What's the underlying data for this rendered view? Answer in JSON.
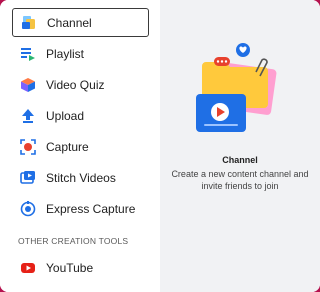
{
  "menu": {
    "items": [
      {
        "label": "Channel",
        "icon": "channel-icon"
      },
      {
        "label": "Playlist",
        "icon": "playlist-icon"
      },
      {
        "label": "Video Quiz",
        "icon": "video-quiz-icon"
      },
      {
        "label": "Upload",
        "icon": "upload-icon"
      },
      {
        "label": "Capture",
        "icon": "capture-icon"
      },
      {
        "label": "Stitch Videos",
        "icon": "stitch-videos-icon"
      },
      {
        "label": "Express Capture",
        "icon": "express-capture-icon"
      }
    ],
    "selected": "Channel"
  },
  "other_tools": {
    "title": "OTHER CREATION TOOLS",
    "items": [
      {
        "label": "YouTube",
        "icon": "youtube-icon"
      }
    ]
  },
  "preview": {
    "title": "Channel",
    "description": "Create a new content channel and invite friends to join"
  },
  "colors": {
    "accent_blue": "#1f6fe5",
    "youtube_red": "#e62117",
    "capture_red": "#e8412d",
    "preview_bg": "#f1f2f4",
    "backdrop": "#b5124e"
  }
}
